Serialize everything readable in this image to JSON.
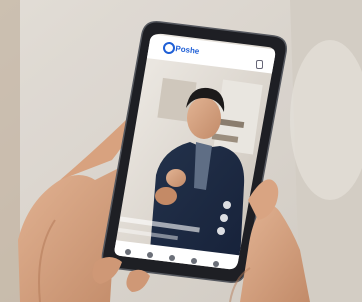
{
  "app": {
    "name": "Poshe"
  },
  "icons": {
    "app_logo": "ring-logo-icon",
    "status": "battery-icon",
    "nav": [
      "home-icon",
      "search-icon",
      "add-icon",
      "inbox-icon",
      "profile-icon"
    ],
    "actions": [
      "heart-icon",
      "comment-icon",
      "share-icon"
    ]
  },
  "colors": {
    "accent": "#1f5fd6",
    "background": "#e7e3dd",
    "phone_frame": "#1e1f24"
  }
}
